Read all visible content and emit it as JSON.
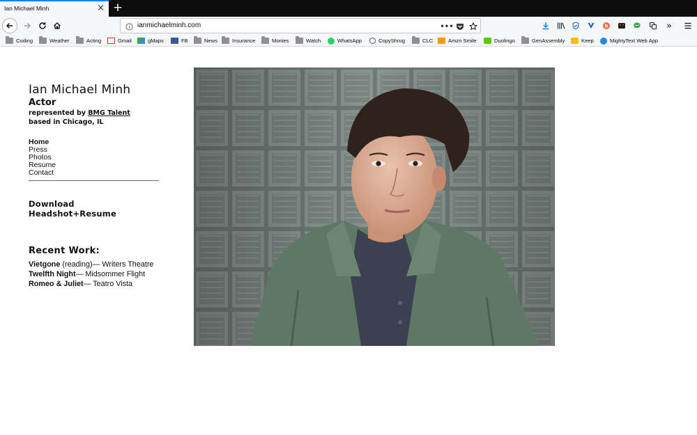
{
  "browser": {
    "tab_title": "Ian Michael Minh",
    "url": "ianmichaelminh.com",
    "url_more": "•••",
    "toolbar_icons": [
      "download-icon",
      "library-icon",
      "shield-icon",
      "extension-icon",
      "extension-icon",
      "extension-icon",
      "extension-icon",
      "extension-icon",
      "overflow-icon",
      "menu-icon"
    ],
    "bookmarks": [
      {
        "label": "Coding",
        "icon": "folder"
      },
      {
        "label": "Weather",
        "icon": "folder"
      },
      {
        "label": "Acting",
        "icon": "folder"
      },
      {
        "label": "Gmail",
        "icon": "gmail"
      },
      {
        "label": "gMaps",
        "icon": "maps"
      },
      {
        "label": "FB",
        "icon": "facebook"
      },
      {
        "label": "News",
        "icon": "folder"
      },
      {
        "label": "Insurance",
        "icon": "folder"
      },
      {
        "label": "Monies",
        "icon": "folder"
      },
      {
        "label": "Watch",
        "icon": "folder"
      },
      {
        "label": "WhatsApp",
        "icon": "whatsapp"
      },
      {
        "label": "CopyShrug",
        "icon": "shrug"
      },
      {
        "label": "CLC",
        "icon": "folder"
      },
      {
        "label": "Amzn Smile",
        "icon": "amazon"
      },
      {
        "label": "Duolingo",
        "icon": "duolingo"
      },
      {
        "label": "GenAssembly",
        "icon": "folder"
      },
      {
        "label": "Keep",
        "icon": "keep"
      },
      {
        "label": "MightyText Web App",
        "icon": "mightytext"
      }
    ]
  },
  "page": {
    "name": "Ian Michael Minh",
    "role": "Actor",
    "represented_prefix": "represented by ",
    "agency": "BMG Talent",
    "location": "based in Chicago, IL",
    "nav": [
      "Home",
      "Press",
      "Photos",
      "Resume",
      "Contact"
    ],
    "download": "Download Headshot+Resume",
    "recent_title": "Recent Work:",
    "works": [
      {
        "show": "Vietgone",
        "note": " (reading)",
        "venue": "— Writers Theatre"
      },
      {
        "show": "Twelfth Night",
        "note": "",
        "venue": "— Midsommer Flight"
      },
      {
        "show": "Romeo & Juliet",
        "note": "",
        "venue": "— Teatro Vista"
      }
    ]
  }
}
